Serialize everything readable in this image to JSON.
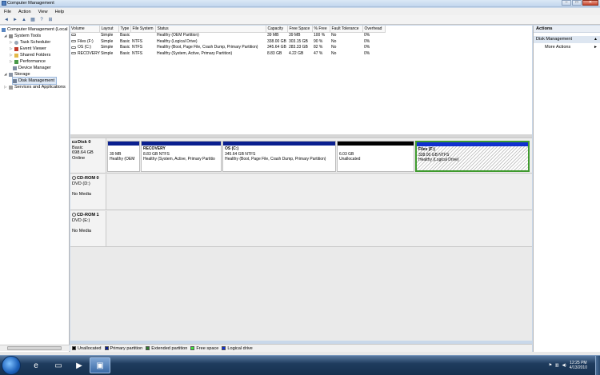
{
  "window": {
    "title": "Computer Management",
    "min": "–",
    "max": "□",
    "close": "✕"
  },
  "menu": [
    "File",
    "Action",
    "View",
    "Help"
  ],
  "toolbar": {
    "back": "◄",
    "forward": "►",
    "up": "▲",
    "view": "▦",
    "help": "?",
    "props": "⊞"
  },
  "tree": {
    "root": "Computer Management (Local",
    "system_tools": "System Tools",
    "task_scheduler": "Task Scheduler",
    "event_viewer": "Event Viewer",
    "shared_folders": "Shared Folders",
    "performance": "Performance",
    "device_manager": "Device Manager",
    "storage": "Storage",
    "disk_management": "Disk Management",
    "services": "Services and Applications"
  },
  "volumes": {
    "headers": [
      "Volume",
      "Layout",
      "Type",
      "File System",
      "Status",
      "Capacity",
      "Free Space",
      "% Free",
      "Fault Tolerance",
      "Overhead"
    ],
    "rows": [
      [
        "",
        "Simple",
        "Basic",
        "",
        "Healthy (OEM Partition)",
        "39 MB",
        "39 MB",
        "100 %",
        "No",
        "0%"
      ],
      [
        "Files (F:)",
        "Simple",
        "Basic",
        "NTFS",
        "Healthy (Logical Drive)",
        "338.00 GB",
        "303.15 GB",
        "90 %",
        "No",
        "0%"
      ],
      [
        "OS (C:)",
        "Simple",
        "Basic",
        "NTFS",
        "Healthy (Boot, Page File, Crash Dump, Primary Partition)",
        "345.64 GB",
        "283.33 GB",
        "82 %",
        "No",
        "0%"
      ],
      [
        "RECOVERY",
        "Simple",
        "Basic",
        "NTFS",
        "Healthy (System, Active, Primary Partition)",
        "8.83 GB",
        "4.22 GB",
        "47 %",
        "No",
        "0%"
      ]
    ]
  },
  "disks": [
    {
      "name": "Disk 0",
      "line2": "Basic",
      "line3": "698.64 GB",
      "line4": "Online"
    },
    {
      "name": "CD-ROM 0",
      "line2": "DVD (D:)",
      "line3": "",
      "line4": "No Media"
    },
    {
      "name": "CD-ROM 1",
      "line2": "DVD (E:)",
      "line3": "",
      "line4": "No Media"
    }
  ],
  "partitions": [
    {
      "title": "",
      "line1": "39 MB",
      "line2": "Healthy (OEM"
    },
    {
      "title": "RECOVERY",
      "line1": "8.83 GB NTFS",
      "line2": "Healthy (System, Active, Primary Partitio"
    },
    {
      "title": "OS  (C:)",
      "line1": "345.64 GB NTFS",
      "line2": "Healthy (Boot, Page File, Crash Dump, Primary Partition)"
    },
    {
      "title": "",
      "line1": "6.03 GB",
      "line2": "Unallocated"
    },
    {
      "title": "Files  (F:)",
      "line1": "338.00 GB NTFS",
      "line2": "Healthy (Logical Drive)"
    }
  ],
  "legend": [
    {
      "label": "Unallocated",
      "color": "#000000"
    },
    {
      "label": "Primary partition",
      "color": "#0a1f8f"
    },
    {
      "label": "Extended partition",
      "color": "#2f7d2f"
    },
    {
      "label": "Free space",
      "color": "#3ee63e"
    },
    {
      "label": "Logical drive",
      "color": "#1030d0"
    }
  ],
  "actions": {
    "header": "Actions",
    "section": "Disk Management",
    "more": "More Actions",
    "arrow_up": "▲",
    "arrow_right": "►"
  },
  "clock": {
    "time": "12:25 PM",
    "date": "4/13/2010"
  },
  "colors": {
    "primary": "#0a1f8f",
    "unallocated": "#000000",
    "logical": "#1030d0",
    "extended": "#2f7d2f"
  }
}
